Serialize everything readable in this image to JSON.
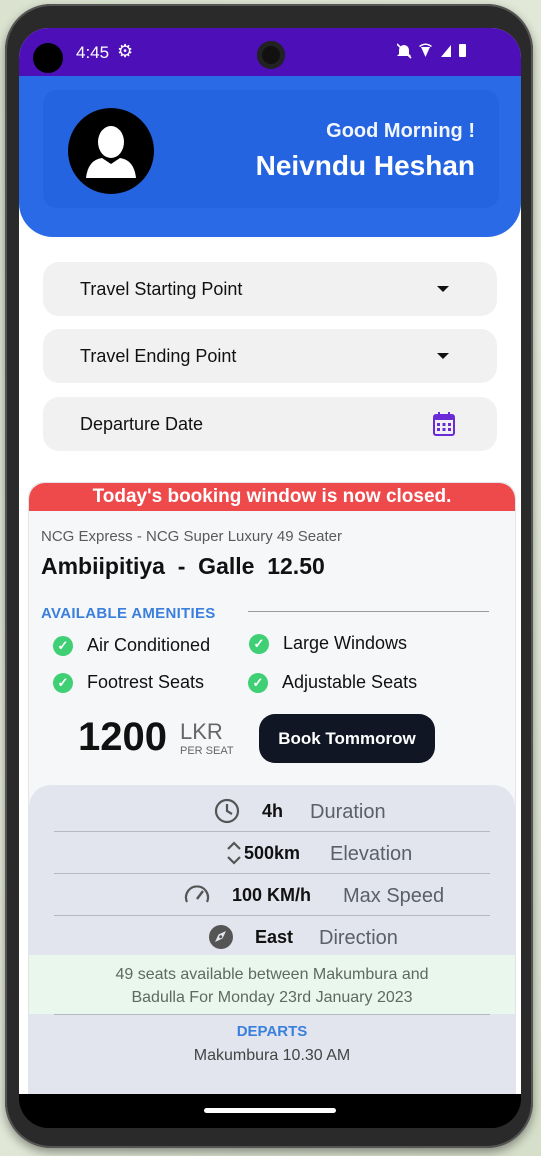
{
  "status_bar": {
    "time": "4:45",
    "left_icon": "gear-icon",
    "right_icons": "🔕 ▾◢ ▮"
  },
  "header": {
    "greeting": "Good Morning !",
    "user_name": "Neivndu Heshan"
  },
  "form": {
    "start_point": "Travel Starting Point",
    "end_point": "Travel Ending Point",
    "departure_date": "Departure Date"
  },
  "card": {
    "banner": "Today's booking window is now closed.",
    "bus_name": "NCG Express - NCG Super Luxury 49 Seater",
    "route": "Ambiipitiya  -  Galle  12.50",
    "amenities_title": "AVAILABLE AMENITIES",
    "amenities": [
      "Air Conditioned",
      "Large Windows",
      "Footrest Seats",
      "Adjustable Seats"
    ],
    "price": "1200",
    "currency": "LKR",
    "per_seat": "PER SEAT",
    "book_button": "Book Tommorow",
    "stats": [
      {
        "value": "4h",
        "label": "Duration",
        "icon": "clock-icon"
      },
      {
        "value": "500km",
        "label": "Elevation",
        "icon": "unfold-icon"
      },
      {
        "value": "100 KM/h",
        "label": "Max Speed",
        "icon": "speedometer-icon"
      },
      {
        "value": "East",
        "label": "Direction",
        "icon": "compass-icon"
      }
    ],
    "availability_line1": "49 seats available between Makumbura and",
    "availability_line2": "Badulla For Monday 23rd January 2023",
    "departs_title": "DEPARTS",
    "departs_value": "Makumbura 10.30 AM"
  },
  "colors": {
    "status_bar": "#4d10b8",
    "header": "#2a6ae6",
    "banner": "#ee4a4c",
    "accent": "#3a7fdc",
    "check": "#3fcf74",
    "button": "#101624"
  }
}
